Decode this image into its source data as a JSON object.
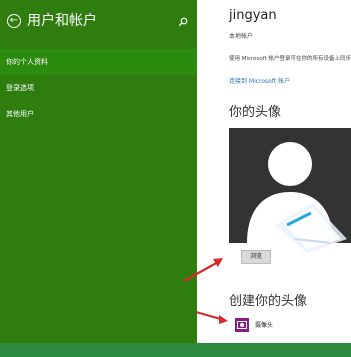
{
  "header": {
    "title": "用户和帐户",
    "back_icon": "back-arrow-icon",
    "search_icon": "search-icon"
  },
  "nav": {
    "items": [
      {
        "label": "你的个人资料",
        "selected": true
      },
      {
        "label": "登录选项",
        "selected": false
      },
      {
        "label": "其他用户",
        "selected": false
      }
    ]
  },
  "profile": {
    "user_name": "jingyan",
    "account_type": "本地帐户",
    "description": "使用 Microsoft 帐户登录可在你的所有设备上同步你的设置、文件和设置的其他浏览历史记录等内容",
    "connect_link": "连接到 Microsoft 帐户"
  },
  "avatar_section": {
    "heading": "你的头像",
    "browse_label": "浏览"
  },
  "create_section": {
    "heading": "创建你的头像",
    "camera_label": "摄像头",
    "camera_icon": "camera-icon"
  },
  "colors": {
    "panel_green": "#2f7d0f",
    "selected_green": "#2a8b0f",
    "bottom_bar": "#2b8a3e",
    "annotation_arrow": "#d42a2a",
    "camera_tile": "#8b1b87",
    "link_blue": "#2a6fb5"
  }
}
